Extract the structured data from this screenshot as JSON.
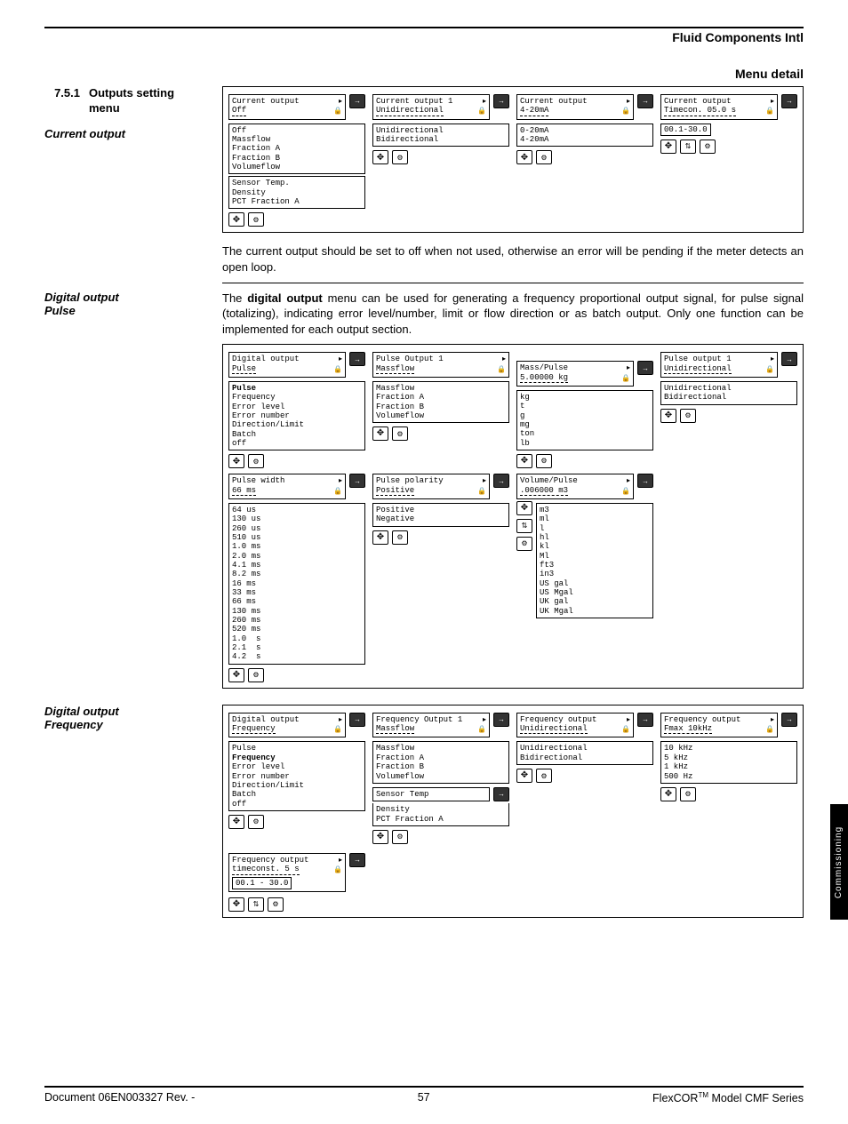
{
  "header": {
    "company": "Fluid Components Intl",
    "menu_detail": "Menu detail"
  },
  "section": {
    "number": "7.5.1",
    "title": "Outputs setting",
    "subtitle": "menu"
  },
  "side_labels": {
    "current_output": "Current output",
    "digital_output_pulse_l1": "Digital output",
    "digital_output_pulse_l2": "Pulse",
    "digital_output_freq_l1": "Digital output",
    "digital_output_freq_l2": "Frequency"
  },
  "diagram1": {
    "col1": {
      "header": "Current output",
      "selected": "Off",
      "options": [
        "Off",
        "Massflow",
        "Fraction A",
        "Fraction B",
        "Volumeflow"
      ],
      "options2": [
        "Sensor Temp.",
        "Density",
        "PCT Fraction A"
      ]
    },
    "col2": {
      "header": "Current output 1",
      "selected": "Unidirectional",
      "options": [
        "Unidirectional",
        "Bidirectional"
      ]
    },
    "col3": {
      "header": "Current output",
      "selected": "4-20mA",
      "options": [
        "0-20mA",
        "4-20mA"
      ]
    },
    "col4": {
      "header": "Current output",
      "selected": "Timecon. 05.0 s",
      "range": "00.1-30.0"
    }
  },
  "paragraph1": "The current output should be set to off when not used, otherwise an error will be pending if the meter detects an open loop.",
  "paragraph2_pre": "The ",
  "paragraph2_bold": "digital output",
  "paragraph2_post": " menu can be used for generating a frequency proportional output signal, for pulse signal (totalizing), indicating error level/number, limit or flow direction or as batch output. Only one function can be implemented for each output section.",
  "diagram2": {
    "row1": {
      "c1": {
        "header": "Digital output",
        "selected": "Pulse",
        "options": [
          "Pulse",
          "Frequency",
          "Error level",
          "Error number",
          "Direction/Limit",
          "Batch",
          "off"
        ]
      },
      "c2": {
        "header": "Pulse Output 1",
        "selected": "Massflow",
        "options": [
          "Massflow",
          "Fraction A",
          "Fraction B",
          "Volumeflow"
        ]
      },
      "c3": {
        "header": "Mass/Pulse",
        "value": "5.00000 kg",
        "units": [
          "kg",
          "t",
          "g",
          "mg",
          "ton",
          "lb"
        ]
      },
      "c4": {
        "header": "Pulse output 1",
        "selected": "Unidirectional",
        "options": [
          "Unidirectional",
          "Bidirectional"
        ]
      }
    },
    "row2": {
      "c1": {
        "header": "Pulse width",
        "selected": "66 ms",
        "options": [
          "64 us",
          "130 us",
          "260 us",
          "510 us",
          "1.0 ms",
          "2.0 ms",
          "4.1 ms",
          "8.2 ms",
          "16 ms",
          "33 ms",
          "66 ms",
          "130 ms",
          "260 ms",
          "520 ms",
          "1.0  s",
          "2.1  s",
          "4.2  s"
        ]
      },
      "c2": {
        "header": "Pulse polarity",
        "selected": "Positive",
        "options": [
          "Positive",
          "Negative"
        ]
      },
      "c3": {
        "header": "Volume/Pulse",
        "value": ".006000 m3",
        "units": [
          "m3",
          "ml",
          "l",
          "hl",
          "kl",
          "Ml",
          "ft3",
          "in3",
          "US gal",
          "US Mgal",
          "UK gal",
          "UK Mgal"
        ]
      }
    }
  },
  "diagram3": {
    "row1": {
      "c1": {
        "header": "Digital output",
        "selected": "Frequency",
        "options": [
          "Pulse",
          "Frequency",
          "Error level",
          "Error number",
          "Direction/Limit",
          "Batch",
          "off"
        ]
      },
      "c2": {
        "header": "Frequency Output 1",
        "selected": "Massflow",
        "options": [
          "Massflow",
          "Fraction A",
          "Fraction B",
          "Volumeflow"
        ],
        "group2_header": "Sensor Temp",
        "group2": [
          "Density",
          "PCT Fraction A"
        ]
      },
      "c3": {
        "header": "Frequency output",
        "selected": "Unidirectional",
        "options": [
          "Unidirectional",
          "Bidirectional"
        ]
      },
      "c4": {
        "header": "Frequency output",
        "selected": "Fmax 10kHz",
        "options": [
          "10 kHz",
          "5 kHz",
          "1 kHz",
          "500 Hz"
        ]
      }
    },
    "row2": {
      "c1": {
        "header": "Frequency output",
        "selected": "timeconst. 5 s",
        "range": "00.1 - 30.0"
      }
    }
  },
  "footer": {
    "doc": "Document 06EN003327 Rev. -",
    "page": "57",
    "product_pre": "FlexCOR",
    "tm": "TM",
    "product_post": " Model CMF Series"
  },
  "side_tab": "Commissioning"
}
